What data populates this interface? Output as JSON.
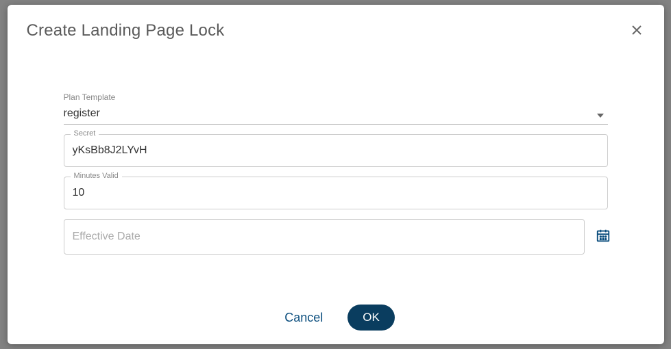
{
  "dialog": {
    "title": "Create Landing Page Lock",
    "fields": {
      "planTemplate": {
        "label": "Plan Template",
        "value": "register"
      },
      "secret": {
        "label": "Secret",
        "value": "yKsBb8J2LYvH"
      },
      "minutesValid": {
        "label": "Minutes Valid",
        "value": "10"
      },
      "effectiveDate": {
        "placeholder": "Effective Date",
        "value": ""
      }
    },
    "buttons": {
      "cancel": "Cancel",
      "ok": "OK"
    }
  }
}
